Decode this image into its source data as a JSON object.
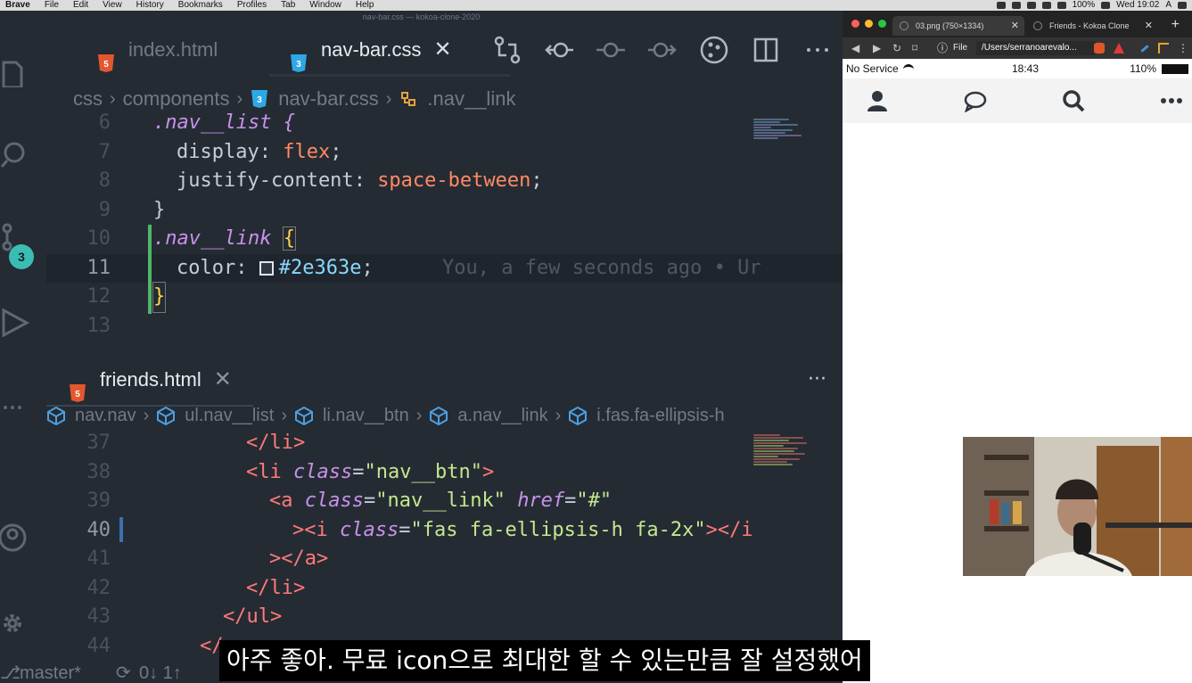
{
  "menubar": {
    "items": [
      "Brave",
      "File",
      "Edit",
      "View",
      "History",
      "Bookmarks",
      "Profiles",
      "Tab",
      "Window",
      "Help"
    ],
    "battery": "100%",
    "clock": "Wed 19:02",
    "input_source": "A"
  },
  "editor": {
    "window_title": "nav-bar.css — kokoa-clone-2020",
    "source_control_badge": "3",
    "tabs": [
      {
        "label": "index.html",
        "active": false
      },
      {
        "label": "nav-bar.css",
        "active": true,
        "close": "✕"
      }
    ],
    "breadcrumb_top": [
      "css",
      "components",
      "nav-bar.css",
      ".nav__link"
    ],
    "code_top": [
      {
        "n": "6",
        "text": ".nav__list {"
      },
      {
        "n": "7",
        "prop": "display",
        "value": "flex"
      },
      {
        "n": "8",
        "prop": "justify-content",
        "value": "space-between"
      },
      {
        "n": "9",
        "text": "}"
      },
      {
        "n": "10",
        "sel": ".nav__link",
        "brace": "{"
      },
      {
        "n": "11",
        "prop": "color",
        "hex": "#2e363e",
        "blame": "You, a few seconds ago • Ur"
      },
      {
        "n": "12",
        "text": "}"
      },
      {
        "n": "13",
        "text": ""
      }
    ],
    "pane2": {
      "tab_label": "friends.html",
      "close": "✕",
      "more": "···",
      "breadcrumb": [
        "nav.nav",
        "ul.nav__list",
        "li.nav__btn",
        "a.nav__link",
        "i.fas.fa-ellipsis-h"
      ]
    },
    "code_bottom": [
      {
        "n": "37",
        "text": "</li>"
      },
      {
        "n": "38",
        "tag_open": "<li",
        "attr": "class",
        "str": "\"nav__btn\"",
        "close": ">"
      },
      {
        "n": "39",
        "tag_open": "<a",
        "attr": "class",
        "str": "\"nav__link\"",
        "attr2": "href",
        "str2": "\"#\""
      },
      {
        "n": "40",
        "tag_open": "><i",
        "attr": "class",
        "str": "\"fas fa-ellipsis-h fa-2x\"",
        "close": "></i"
      },
      {
        "n": "41",
        "text": "></a>"
      },
      {
        "n": "42",
        "text": "</li>"
      },
      {
        "n": "43",
        "text": "</ul>"
      },
      {
        "n": "44",
        "text": "</"
      }
    ],
    "status": {
      "branch": "master*",
      "sync": "0↓ 1↑"
    }
  },
  "browser": {
    "tabs": [
      {
        "label": "03.png (750×1334)"
      },
      {
        "label": "Friends - Kokoa Clone"
      }
    ],
    "new_tab": "+",
    "address_scheme": "File",
    "address": "/Users/serranoarevalo...",
    "phone_status": {
      "carrier": "No Service",
      "time": "18:43",
      "battery": "110%"
    },
    "nav_icons": [
      "user-icon",
      "comment-icon",
      "search-icon",
      "ellipsis-icon"
    ]
  },
  "subtitle": "아주 좋아. 무료 icon으로 최대한 할 수 있는만큼 잘 설정했어",
  "colors": {
    "editor_bg": "#252b33",
    "accent_teal": "#3bbcb5",
    "swatch": "#2e363e"
  }
}
